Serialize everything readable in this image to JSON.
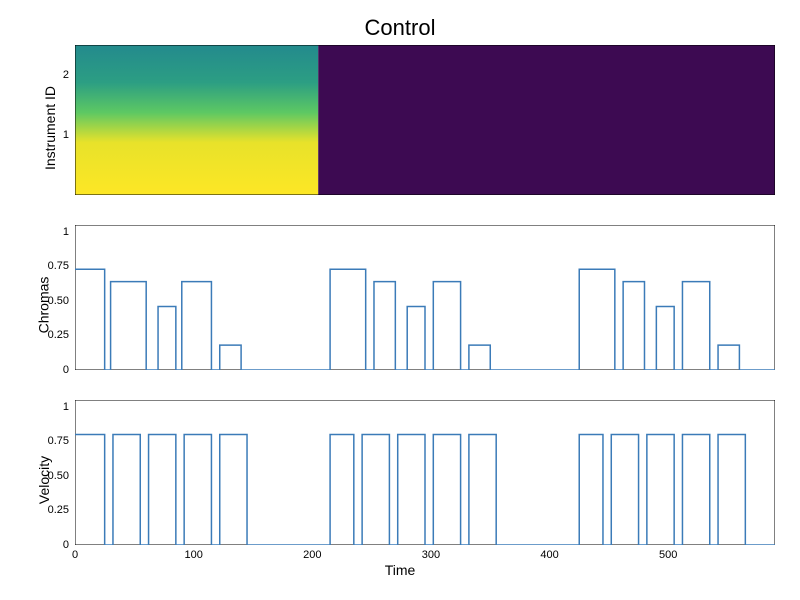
{
  "title": "Control",
  "xlabel": "Time",
  "panels": [
    {
      "ylabel": "Instrument ID",
      "yticks": [
        1,
        2
      ],
      "type": "heatmap",
      "ylim": [
        0,
        2.5
      ],
      "heat_split_x": 205,
      "heat_right_color": "#3d0a52"
    },
    {
      "ylabel": "Chromas",
      "yticks": [
        0.0,
        0.25,
        0.5,
        0.75,
        1.0
      ],
      "type": "line",
      "ylim": [
        0,
        1.05
      ]
    },
    {
      "ylabel": "Velocity",
      "yticks": [
        0.0,
        0.25,
        0.5,
        0.75,
        1.0
      ],
      "type": "line",
      "ylim": [
        0,
        1.05
      ]
    }
  ],
  "xticks": [
    0,
    100,
    200,
    300,
    400,
    500
  ],
  "xlim": [
    0,
    590
  ],
  "chart_data": [
    {
      "type": "heatmap",
      "title": "Instrument ID",
      "xlim": [
        0,
        590
      ],
      "ylim": [
        0,
        2.5
      ],
      "description": "Left region x=[0,205]: viridis vertical gradient (yellow at bottom row 0, teal at top row 2). Right region x=[205,590]: uniform dark purple (value 0).",
      "rows": 3,
      "left_region_values_by_row": [
        1.0,
        0.5,
        0.45
      ],
      "right_region_value": 0.0
    },
    {
      "type": "line",
      "title": "Chromas",
      "ylim": [
        0,
        1.0
      ],
      "x": [
        0,
        25,
        25,
        30,
        30,
        60,
        60,
        70,
        70,
        85,
        85,
        90,
        90,
        115,
        115,
        122,
        122,
        140,
        140,
        150,
        150,
        215,
        215,
        245,
        245,
        252,
        252,
        270,
        270,
        280,
        280,
        295,
        295,
        302,
        302,
        325,
        325,
        332,
        332,
        350,
        350,
        360,
        360,
        425,
        425,
        455,
        455,
        462,
        462,
        480,
        480,
        490,
        490,
        505,
        505,
        512,
        512,
        535,
        535,
        542,
        542,
        560,
        560,
        570,
        570,
        590
      ],
      "y": [
        0.73,
        0.73,
        0,
        0,
        0.64,
        0.64,
        0,
        0,
        0.46,
        0.46,
        0,
        0,
        0.64,
        0.64,
        0,
        0,
        0.18,
        0.18,
        0,
        0,
        0,
        0,
        0.73,
        0.73,
        0,
        0,
        0.64,
        0.64,
        0,
        0,
        0.46,
        0.46,
        0,
        0,
        0.64,
        0.64,
        0,
        0,
        0.18,
        0.18,
        0,
        0,
        0,
        0,
        0.73,
        0.73,
        0,
        0,
        0.64,
        0.64,
        0,
        0,
        0.46,
        0.46,
        0,
        0,
        0.64,
        0.64,
        0,
        0,
        0.18,
        0.18,
        0,
        0,
        0,
        0
      ]
    },
    {
      "type": "line",
      "title": "Velocity",
      "ylim": [
        0,
        1.0
      ],
      "x": [
        0,
        25,
        25,
        32,
        32,
        55,
        55,
        62,
        62,
        85,
        85,
        92,
        92,
        115,
        115,
        122,
        122,
        145,
        145,
        155,
        155,
        215,
        215,
        235,
        235,
        242,
        242,
        265,
        265,
        272,
        272,
        295,
        295,
        302,
        302,
        325,
        325,
        332,
        332,
        355,
        355,
        365,
        365,
        425,
        425,
        445,
        445,
        452,
        452,
        475,
        475,
        482,
        482,
        505,
        505,
        512,
        512,
        535,
        535,
        542,
        542,
        565,
        565,
        575,
        575,
        590
      ],
      "y": [
        0.8,
        0.8,
        0,
        0,
        0.8,
        0.8,
        0,
        0,
        0.8,
        0.8,
        0,
        0,
        0.8,
        0.8,
        0,
        0,
        0.8,
        0.8,
        0,
        0,
        0,
        0,
        0.8,
        0.8,
        0,
        0,
        0.8,
        0.8,
        0,
        0,
        0.8,
        0.8,
        0,
        0,
        0.8,
        0.8,
        0,
        0,
        0.8,
        0.8,
        0,
        0,
        0,
        0,
        0.8,
        0.8,
        0,
        0,
        0.8,
        0.8,
        0,
        0,
        0.8,
        0.8,
        0,
        0,
        0.8,
        0.8,
        0,
        0,
        0.8,
        0.8,
        0,
        0,
        0,
        0
      ]
    }
  ]
}
